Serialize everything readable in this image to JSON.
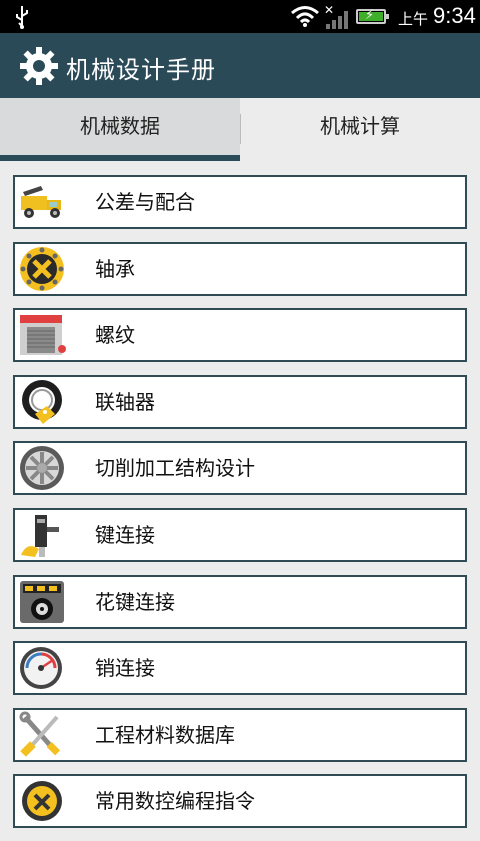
{
  "status_bar": {
    "ampm": "上午",
    "time": "9:34",
    "icons": [
      "usb-icon",
      "wifi-icon",
      "signal-icon",
      "battery-icon"
    ]
  },
  "header": {
    "title": "机械设计手册",
    "icon": "gear-icon",
    "color": "#2b4a57"
  },
  "tabs": [
    {
      "label": "机械数据",
      "selected": true
    },
    {
      "label": "机械计算",
      "selected": false
    }
  ],
  "list": {
    "items": [
      {
        "label": "公差与配合",
        "icon": "truck-icon"
      },
      {
        "label": "轴承",
        "icon": "tire-badge-icon"
      },
      {
        "label": "螺纹",
        "icon": "garage-icon"
      },
      {
        "label": "联轴器",
        "icon": "tire-tag-icon"
      },
      {
        "label": "切削加工结构设计",
        "icon": "wheel-rim-icon"
      },
      {
        "label": "键连接",
        "icon": "spray-gun-icon"
      },
      {
        "label": "花键连接",
        "icon": "dashboard-display-icon"
      },
      {
        "label": "销连接",
        "icon": "gauge-icon"
      },
      {
        "label": "工程材料数据库",
        "icon": "tools-icon"
      },
      {
        "label": "常用数控编程指令",
        "icon": "badge-icon"
      }
    ]
  }
}
